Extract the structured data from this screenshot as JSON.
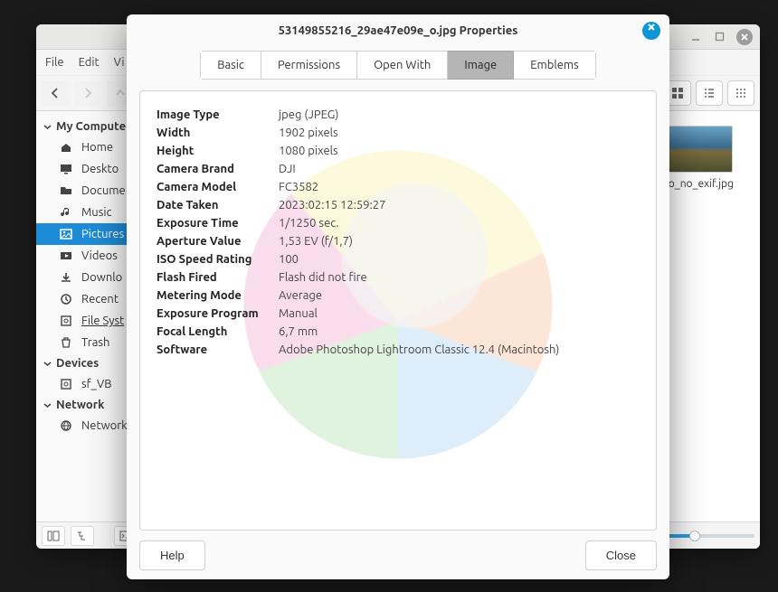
{
  "fm": {
    "menubar": [
      "File",
      "Edit",
      "Vi"
    ],
    "sidebar": {
      "headers": [
        "My Compute",
        "Devices",
        "Network"
      ],
      "computer": [
        {
          "icon": "home",
          "label": "Home"
        },
        {
          "icon": "desktop",
          "label": "Deskto"
        },
        {
          "icon": "folder",
          "label": "Docume"
        },
        {
          "icon": "music",
          "label": "Music"
        },
        {
          "icon": "picture",
          "label": "Pictures"
        },
        {
          "icon": "video",
          "label": "Videos"
        },
        {
          "icon": "download",
          "label": "Downlo"
        },
        {
          "icon": "recent",
          "label": "Recent"
        },
        {
          "icon": "disk",
          "label": "File Syst"
        },
        {
          "icon": "trash",
          "label": "Trash"
        }
      ],
      "devices": [
        {
          "icon": "disk",
          "label": "sf_VB"
        }
      ],
      "network": [
        {
          "icon": "globe",
          "label": "Network"
        }
      ],
      "active_index": 4
    },
    "file": {
      "name": "oto_no_exif.jpg"
    }
  },
  "dialog": {
    "title": "53149855216_29ae47e09e_o.jpg Properties",
    "tabs": [
      "Basic",
      "Permissions",
      "Open With",
      "Image",
      "Emblems"
    ],
    "active_tab": 3,
    "buttons": {
      "help": "Help",
      "close": "Close"
    },
    "image_properties": [
      {
        "key": "Image Type",
        "value": "jpeg (JPEG)"
      },
      {
        "key": "Width",
        "value": "1902 pixels"
      },
      {
        "key": "Height",
        "value": "1080 pixels"
      },
      {
        "key": "Camera Brand",
        "value": "DJI"
      },
      {
        "key": "Camera Model",
        "value": "FC3582"
      },
      {
        "key": "Date Taken",
        "value": "2023:02:15 12:59:27"
      },
      {
        "key": "Exposure Time",
        "value": "1/1250 sec."
      },
      {
        "key": "Aperture Value",
        "value": "1,53 EV (f/1,7)"
      },
      {
        "key": "ISO Speed Rating",
        "value": "100"
      },
      {
        "key": "Flash Fired",
        "value": "Flash did not fire"
      },
      {
        "key": "Metering Mode",
        "value": "Average"
      },
      {
        "key": "Exposure Program",
        "value": "Manual"
      },
      {
        "key": "Focal Length",
        "value": "6,7 mm"
      },
      {
        "key": "Software",
        "value": "Adobe Photoshop Lightroom Classic 12.4 (Macintosh)"
      }
    ]
  }
}
